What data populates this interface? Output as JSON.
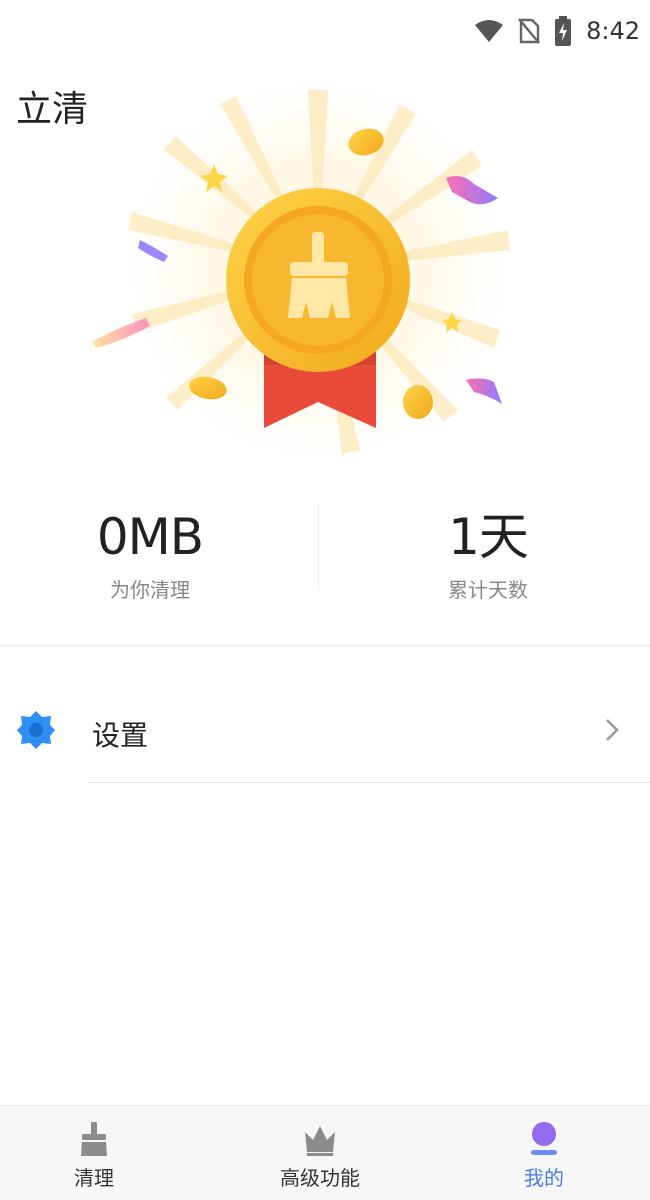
{
  "status_bar": {
    "time": "8:42",
    "icons": [
      "wifi-icon",
      "no-sim-icon",
      "battery-charging-icon"
    ]
  },
  "header": {
    "title": "立清"
  },
  "hero": {
    "icon": "medal-broom-icon"
  },
  "stats": {
    "cleaned": {
      "value": "0MB",
      "label": "为你清理"
    },
    "days": {
      "value": "1天",
      "label": "累计天数"
    }
  },
  "menu": {
    "settings": {
      "label": "设置",
      "icon": "gear-icon"
    }
  },
  "bottom_nav": {
    "items": [
      {
        "label": "清理",
        "icon": "broom-icon",
        "active": false
      },
      {
        "label": "高级功能",
        "icon": "crown-icon",
        "active": false
      },
      {
        "label": "我的",
        "icon": "profile-icon",
        "active": true
      }
    ]
  },
  "colors": {
    "accent": "#4a7cf0",
    "medal_gold": "#f8b82c",
    "ribbon_red": "#e84b3a",
    "settings_blue": "#2f8ff5"
  }
}
